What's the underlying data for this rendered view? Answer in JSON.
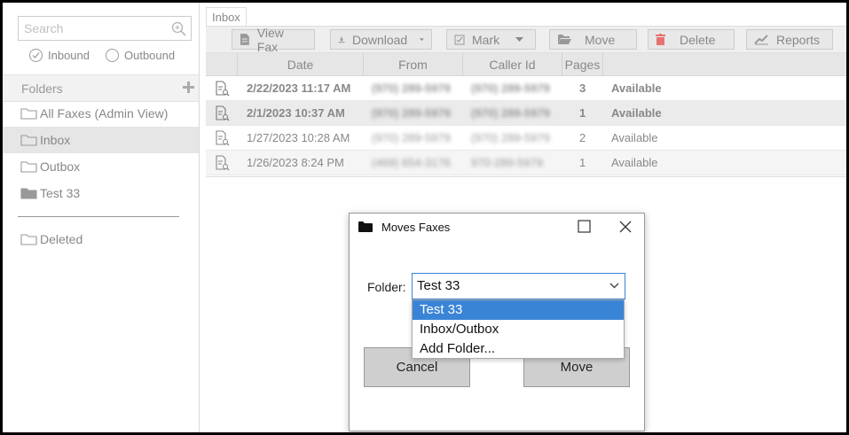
{
  "sidebar": {
    "search_placeholder": "Search",
    "filters": [
      "Inbound",
      "Outbound"
    ],
    "folders_title": "Folders",
    "folders": [
      "All Faxes (Admin View)",
      "Inbox",
      "Outbox",
      "Test 33"
    ],
    "deleted": "Deleted"
  },
  "tab": {
    "label": "Inbox"
  },
  "toolbar": {
    "view_fax": "View Fax",
    "download": "Download",
    "mark": "Mark",
    "move": "Move",
    "delete": "Delete",
    "reports": "Reports"
  },
  "grid": {
    "columns": [
      "Date",
      "From",
      "Caller Id",
      "Pages"
    ],
    "rows": [
      {
        "date": "2/22/2023 11:17 AM",
        "from": "(970) 289-5979",
        "caller_id": "(970) 289-5979",
        "pages": "3",
        "status": "Available"
      },
      {
        "date": "2/1/2023 10:37 AM",
        "from": "(970) 289-5979",
        "caller_id": "(970) 289-5979",
        "pages": "1",
        "status": "Available"
      },
      {
        "date": "1/27/2023 10:28 AM",
        "from": "(970) 289-5979",
        "caller_id": "(970) 289-5979",
        "pages": "2",
        "status": "Available"
      },
      {
        "date": "1/26/2023 8:24 PM",
        "from": "(469) 654-3176",
        "caller_id": "970-289-5979",
        "pages": "1",
        "status": "Available"
      }
    ]
  },
  "dialog": {
    "title": "Moves Faxes",
    "folder_label": "Folder:",
    "selected": "Test 33",
    "options": [
      "Test 33",
      "Inbox/Outbox",
      "Add Folder..."
    ],
    "cancel": "Cancel",
    "move": "Move"
  },
  "colors": {
    "accent": "#3a84d6",
    "delete_icon": "#e57373"
  }
}
